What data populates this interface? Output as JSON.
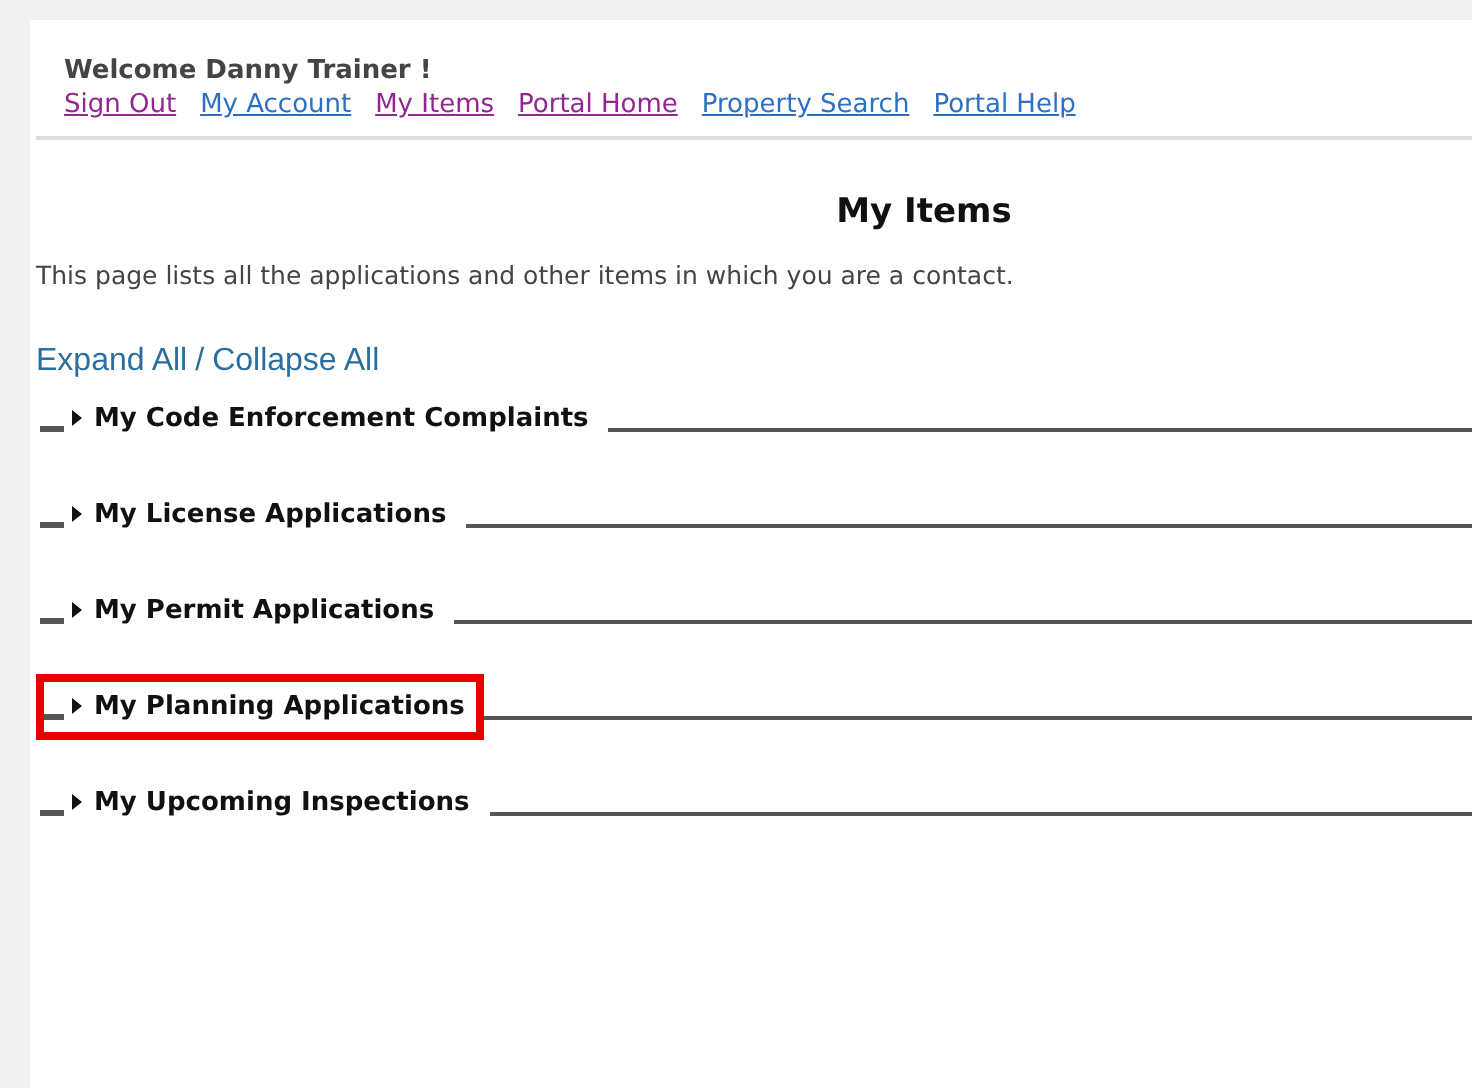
{
  "header": {
    "welcome": "Welcome Danny Trainer !",
    "links": [
      {
        "label": "Sign Out",
        "visited": true
      },
      {
        "label": "My Account",
        "visited": false
      },
      {
        "label": "My Items",
        "visited": true
      },
      {
        "label": "Portal Home",
        "visited": true
      },
      {
        "label": "Property Search",
        "visited": false
      },
      {
        "label": "Portal Help",
        "visited": false
      }
    ]
  },
  "title": "My Items",
  "description": "This page lists all the applications and other items in which you are a contact.",
  "expand_all": "Expand All",
  "separator": "/",
  "collapse_all": "Collapse All",
  "sections": [
    {
      "label": "My Code Enforcement Complaints",
      "highlighted": false
    },
    {
      "label": "My License Applications",
      "highlighted": false
    },
    {
      "label": "My Permit Applications",
      "highlighted": false
    },
    {
      "label": "My Planning Applications",
      "highlighted": true
    },
    {
      "label": "My Upcoming Inspections",
      "highlighted": false
    }
  ]
}
